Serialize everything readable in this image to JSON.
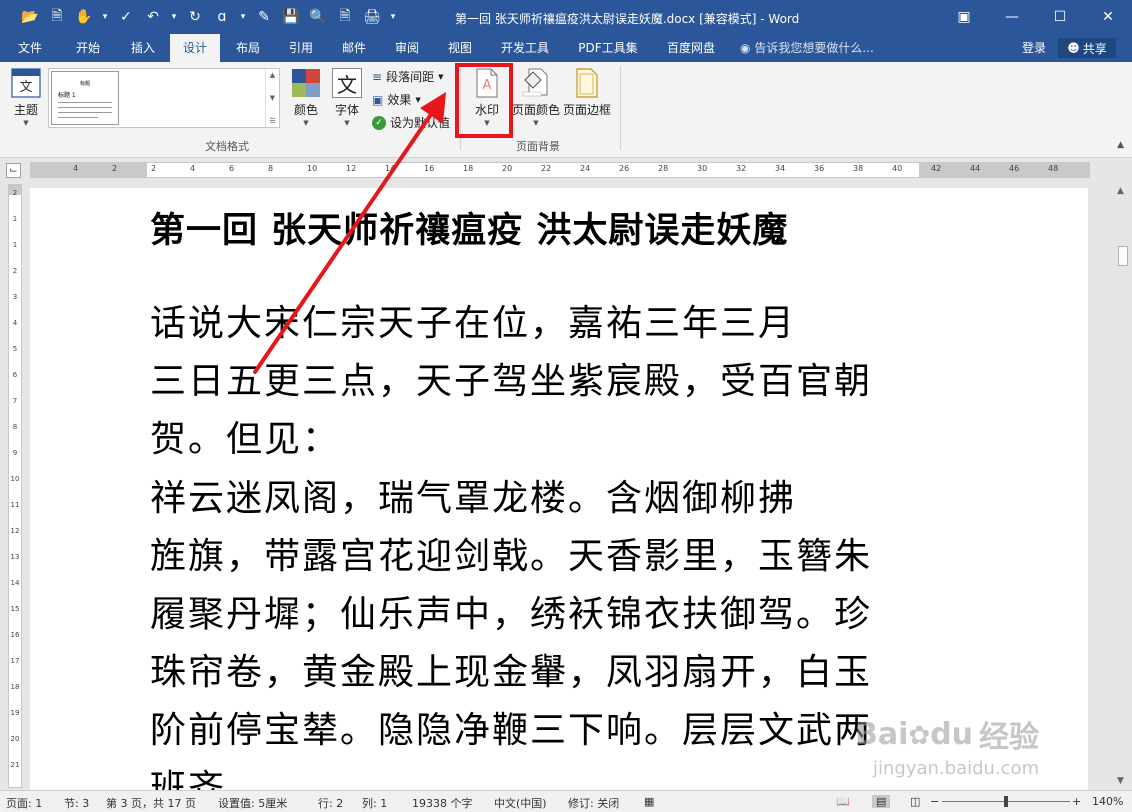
{
  "window": {
    "title": "第一回 张天师祈禳瘟疫洪太尉误走妖魔.docx [兼容模式] - Word"
  },
  "qat": {
    "icons": [
      "open-icon",
      "new-icon",
      "touch-mode-icon",
      "spelling-icon",
      "undo-icon",
      "redo-icon",
      "format-painter-icon",
      "edit-icon",
      "save-icon",
      "find-icon",
      "print-preview-icon",
      "customize-icon"
    ]
  },
  "tabs": [
    {
      "label": "文件",
      "active": false
    },
    {
      "label": "开始",
      "active": false
    },
    {
      "label": "插入",
      "active": false
    },
    {
      "label": "设计",
      "active": true
    },
    {
      "label": "布局",
      "active": false
    },
    {
      "label": "引用",
      "active": false
    },
    {
      "label": "邮件",
      "active": false
    },
    {
      "label": "审阅",
      "active": false
    },
    {
      "label": "视图",
      "active": false
    },
    {
      "label": "开发工具",
      "active": false
    },
    {
      "label": "PDF工具集",
      "active": false
    },
    {
      "label": "百度网盘",
      "active": false
    }
  ],
  "tell_me": "告诉我您想要做什么...",
  "account": {
    "login": "登录",
    "share": "共享"
  },
  "ribbon": {
    "theme_label": "主题",
    "gallery_thumb_title": "标题",
    "gallery_thumb_heading": "标题 1",
    "colors_label": "颜色",
    "fonts_label": "字体",
    "fonts_glyph": "文",
    "paragraph_spacing": "段落间距",
    "effects": "效果",
    "set_default": "设为默认值",
    "group_document_format": "文档格式",
    "watermark_label": "水印",
    "page_color_label": "页面颜色",
    "page_borders_label": "页面边框",
    "group_page_background": "页面背景",
    "highlight_color": "#e8151a"
  },
  "ruler": {
    "h_numbers": [
      "4",
      "2",
      "2",
      "4",
      "6",
      "8",
      "10",
      "12",
      "14",
      "16",
      "18",
      "20",
      "22",
      "24",
      "26",
      "28",
      "30",
      "32",
      "34",
      "36",
      "38",
      "40",
      "42",
      "44",
      "46",
      "48"
    ],
    "v_numbers": [
      "2",
      "1",
      "1",
      "2",
      "3",
      "4",
      "5",
      "6",
      "7",
      "8",
      "9",
      "10",
      "11",
      "12",
      "13",
      "14",
      "15",
      "16",
      "17",
      "18",
      "19",
      "20",
      "21"
    ]
  },
  "document": {
    "heading": "第一回  张天师祈禳瘟疫    洪太尉误走妖魔",
    "lines": [
      "    话说大宋仁宗天子在位，嘉祐三年三月",
      "三日五更三点，天子驾坐紫宸殿，受百官朝",
      "贺。但见：",
      "    祥云迷凤阁，瑞气罩龙楼。含烟御柳拂",
      "旌旗，带露宫花迎剑戟。天香影里，玉簪朱",
      "履聚丹墀；仙乐声中，绣袄锦衣扶御驾。珍",
      "珠帘卷，黄金殿上现金轝，凤羽扇开，白玉",
      "阶前停宝辇。隐隐净鞭三下响。层层文武两",
      "班齐。"
    ]
  },
  "statusbar": {
    "page_label": "页面: 1",
    "section": "节: 3",
    "page_of": "第 3 页，共 17 页",
    "position": "设置值: 5厘米",
    "line": "行: 2",
    "column": "列: 1",
    "word_count": "19338 个字",
    "language": "中文(中国)",
    "track_changes": "修订: 关闭",
    "zoom": "140%"
  },
  "watermark_brand": {
    "logo_text": "Bai",
    "logo_text2": "du",
    "cn": "经验",
    "url": "jingyan.baidu.com"
  },
  "colors": {
    "word_blue": "#2b579a",
    "arrow_red": "#e8151a"
  }
}
